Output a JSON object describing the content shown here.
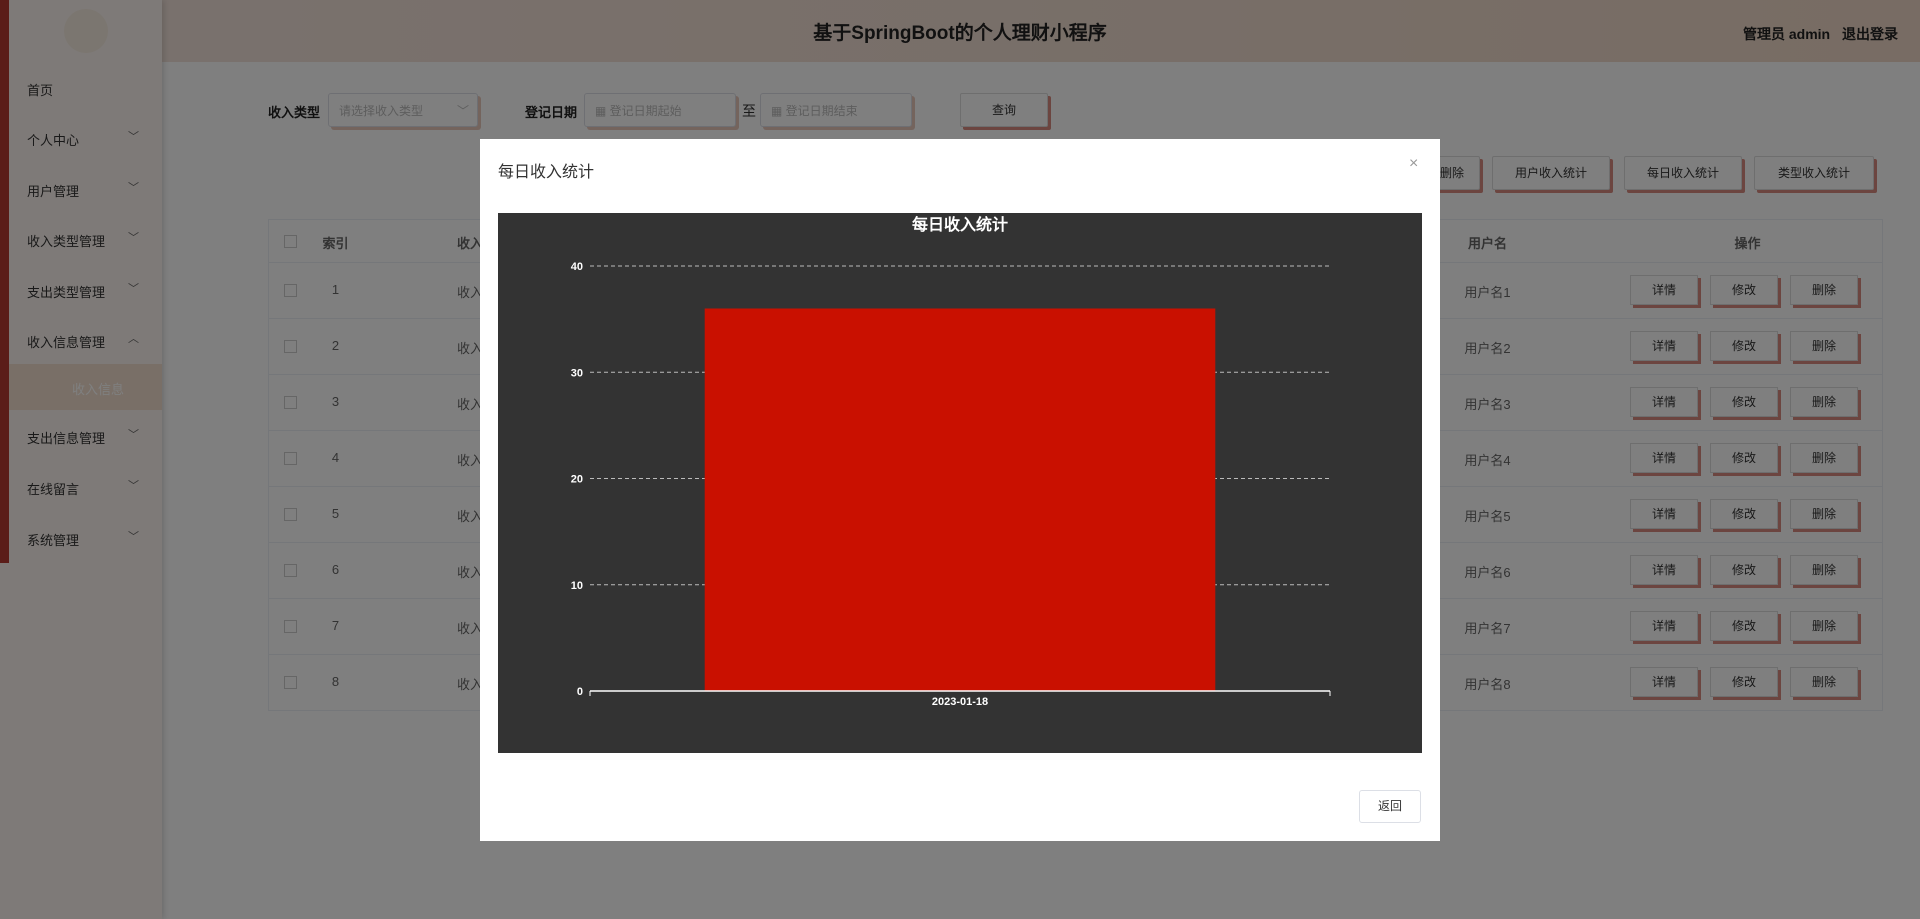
{
  "app": {
    "title": "基于SpringBoot的个人理财小程序",
    "user_label": "管理员 admin",
    "logout_label": "退出登录"
  },
  "sidebar": {
    "items": [
      {
        "label": "首页",
        "chevron": ""
      },
      {
        "label": "个人中心",
        "chevron": "﹀"
      },
      {
        "label": "用户管理",
        "chevron": "﹀"
      },
      {
        "label": "收入类型管理",
        "chevron": "﹀"
      },
      {
        "label": "支出类型管理",
        "chevron": "﹀"
      },
      {
        "label": "收入信息管理",
        "chevron": "︿"
      },
      {
        "label": "支出信息管理",
        "chevron": "﹀"
      },
      {
        "label": "在线留言",
        "chevron": "﹀"
      },
      {
        "label": "系统管理",
        "chevron": "﹀"
      }
    ],
    "active_sub_label": "收入信息"
  },
  "filters": {
    "type_label": "收入类型",
    "type_placeholder": "请选择收入类型",
    "date_label": "登记日期",
    "date_start_placeholder": "登记日期起始",
    "date_sep": "至",
    "date_end_placeholder": "登记日期结束",
    "query_label": "查询"
  },
  "toolbar": {
    "delete_label": "删除",
    "user_stats_label": "用户收入统计",
    "daily_stats_label": "每日收入统计",
    "type_stats_label": "类型收入统计"
  },
  "table": {
    "headers": {
      "index": "索引",
      "income": "收入",
      "username": "用户名",
      "actions": "操作"
    },
    "rows": [
      {
        "index": "1",
        "income": "收入",
        "username": "用户名1"
      },
      {
        "index": "2",
        "income": "收入",
        "username": "用户名2"
      },
      {
        "index": "3",
        "income": "收入",
        "username": "用户名3"
      },
      {
        "index": "4",
        "income": "收入",
        "username": "用户名4"
      },
      {
        "index": "5",
        "income": "收入",
        "username": "用户名5"
      },
      {
        "index": "6",
        "income": "收入",
        "username": "用户名6"
      },
      {
        "index": "7",
        "income": "收入",
        "username": "用户名7"
      },
      {
        "index": "8",
        "income": "收入",
        "username": "用户名8"
      }
    ],
    "detail_label": "详情",
    "edit_label": "修改",
    "delete_label": "删除"
  },
  "modal": {
    "title": "每日收入统计",
    "close_icon": "×",
    "back_label": "返回"
  },
  "chart_data": {
    "type": "bar",
    "title": "每日收入统计",
    "categories": [
      "2023-01-18"
    ],
    "values": [
      36
    ],
    "ylim": [
      0,
      40
    ],
    "yticks": [
      0,
      10,
      20,
      30,
      40
    ],
    "xlabel": "",
    "ylabel": "",
    "grid": true,
    "bar_color": "#c91000",
    "background": "#333333"
  }
}
